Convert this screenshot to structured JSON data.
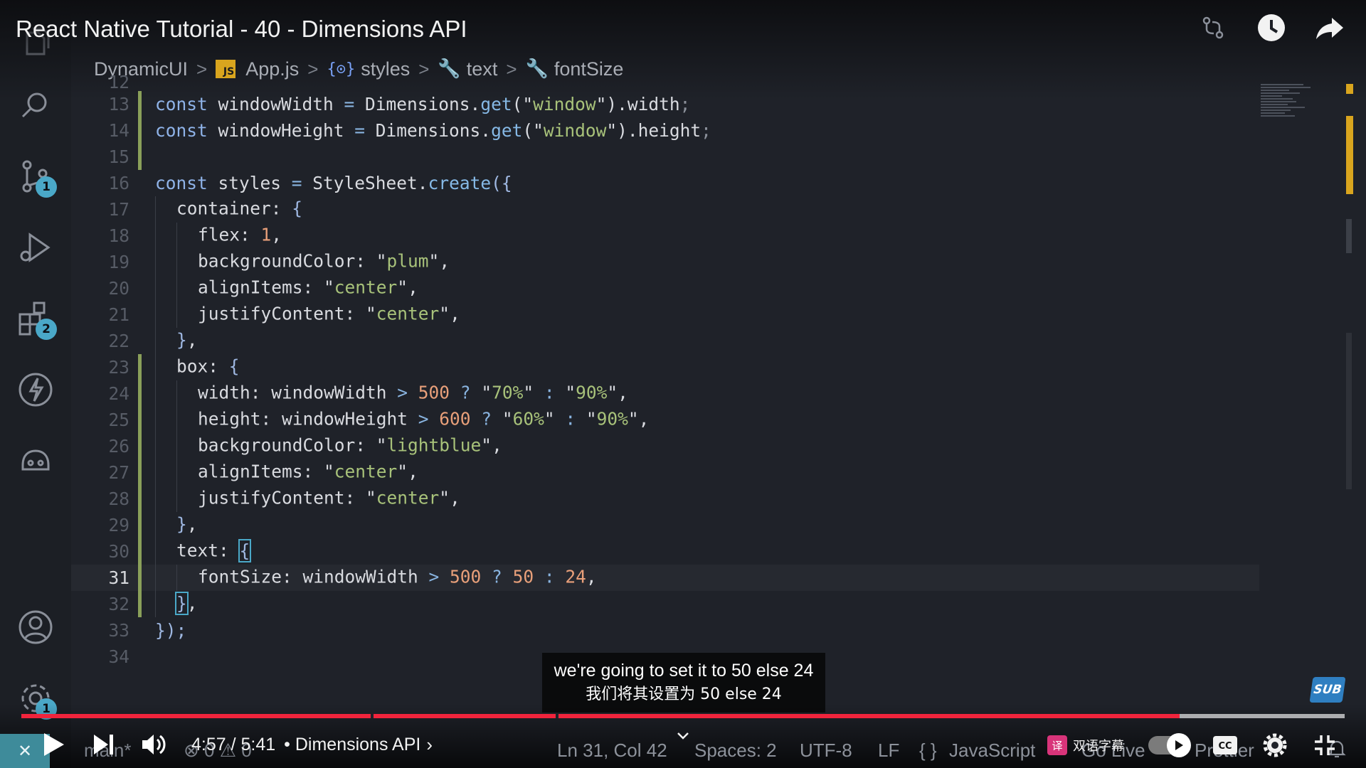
{
  "video": {
    "title": "React Native Tutorial - 40 - Dimensions API",
    "time_display": "4:57 / 5:41",
    "chapter_label": "• Dimensions API",
    "chapter_chevron": "›",
    "progress_played": 0.875,
    "progress_buffered": 1.0,
    "chapter_marks": [
      0.264,
      0.404
    ],
    "subtitle_en": "we're going to set it to 50 else 24",
    "subtitle_zh": "我们将其设置为 50 else 24",
    "sub_logo": "SUB",
    "bilingual_label": "双语字幕",
    "bilingual_icon": "译"
  },
  "breadcrumb": {
    "project": "DynamicUI",
    "js_badge": "JS",
    "file": "App.js",
    "symbol_icon": "{⊙}",
    "symbol1": "styles",
    "symbol2": "text",
    "symbol3": "fontSize",
    "sep": ">",
    "wrench": "🔧"
  },
  "activity": {
    "source_control_badge": "1",
    "extensions_badge": "2",
    "settings_badge": "1"
  },
  "status_bar": {
    "remote": "✕",
    "branch": "main*",
    "problems": "⊗ 0 ⚠ 0",
    "position": "Ln 31, Col 42",
    "spaces": "Spaces: 2",
    "encoding": "UTF-8",
    "eol": "LF",
    "braces": "{ }",
    "language": "JavaScript",
    "go_live": "Go Live",
    "prettier": "✓ Prettier"
  },
  "code_lines": [
    {
      "n": "12"
    },
    {
      "n": "13"
    },
    {
      "n": "14"
    },
    {
      "n": "15"
    },
    {
      "n": "16"
    },
    {
      "n": "17"
    },
    {
      "n": "18"
    },
    {
      "n": "19"
    },
    {
      "n": "20"
    },
    {
      "n": "21"
    },
    {
      "n": "22"
    },
    {
      "n": "23"
    },
    {
      "n": "24"
    },
    {
      "n": "25"
    },
    {
      "n": "26"
    },
    {
      "n": "27"
    },
    {
      "n": "28"
    },
    {
      "n": "29"
    },
    {
      "n": "30"
    },
    {
      "n": "31"
    },
    {
      "n": "32"
    },
    {
      "n": "33"
    },
    {
      "n": "34"
    }
  ],
  "code": {
    "l13": {
      "kw": "const",
      "name": " windowWidth ",
      "eq": "=",
      "obj": " Dimensions.",
      "fn": "get",
      "p1": "(\"",
      "str": "window",
      "p2": "\")",
      "prop": ".width",
      "semi": ";"
    },
    "l14": {
      "kw": "const",
      "name": " windowHeight ",
      "eq": "=",
      "obj": " Dimensions.",
      "fn": "get",
      "p1": "(\"",
      "str": "window",
      "p2": "\")",
      "prop": ".height",
      "semi": ";"
    },
    "l16": {
      "kw": "const",
      "name": " styles ",
      "eq": "=",
      "obj": " StyleSheet.",
      "fn": "create",
      "brk": "({"
    },
    "l17": {
      "key": "container: ",
      "brk": "{"
    },
    "l18": {
      "key": "flex: ",
      "num": "1",
      "end": ","
    },
    "l19": {
      "key": "backgroundColor: ",
      "q1": "\"",
      "str": "plum",
      "q2": "\"",
      "end": ","
    },
    "l20": {
      "key": "alignItems: ",
      "q1": "\"",
      "str": "center",
      "q2": "\"",
      "end": ","
    },
    "l21": {
      "key": "justifyContent: ",
      "q1": "\"",
      "str": "center",
      "q2": "\"",
      "end": ","
    },
    "l22": {
      "brk": "}",
      "end": ","
    },
    "l23": {
      "key": "box: ",
      "brk": "{"
    },
    "l24": {
      "key": "width: windowWidth ",
      "op1": ">",
      "num": " 500",
      "op2": " ?",
      "q1": " \"",
      "s1": "70%",
      "q2": "\"",
      "op3": " :",
      "q3": " \"",
      "s2": "90%",
      "q4": "\"",
      "end": ","
    },
    "l25": {
      "key": "height: windowHeight ",
      "op1": ">",
      "num": " 600",
      "op2": " ?",
      "q1": " \"",
      "s1": "60%",
      "q2": "\"",
      "op3": " :",
      "q3": " \"",
      "s2": "90%",
      "q4": "\"",
      "end": ","
    },
    "l26": {
      "key": "backgroundColor: ",
      "q1": "\"",
      "str": "lightblue",
      "q2": "\"",
      "end": ","
    },
    "l27": {
      "key": "alignItems: ",
      "q1": "\"",
      "str": "center",
      "q2": "\"",
      "end": ","
    },
    "l28": {
      "key": "justifyContent: ",
      "q1": "\"",
      "str": "center",
      "q2": "\"",
      "end": ","
    },
    "l29": {
      "brk": "}",
      "end": ","
    },
    "l30": {
      "key": "text: ",
      "brk": "{"
    },
    "l31": {
      "key": "fontSize: windowWidth ",
      "op1": ">",
      "num1": " 500",
      "op2": " ?",
      "num2": " 50",
      "op3": " :",
      "num3": " 24",
      "end": ","
    },
    "l32": {
      "brk": "}",
      "end": ","
    },
    "l33": {
      "brk": "});"
    }
  },
  "colors": {
    "accent_red": "#f0243c",
    "git_modified": "#8aa05a",
    "badge": "#4aa8c8"
  }
}
